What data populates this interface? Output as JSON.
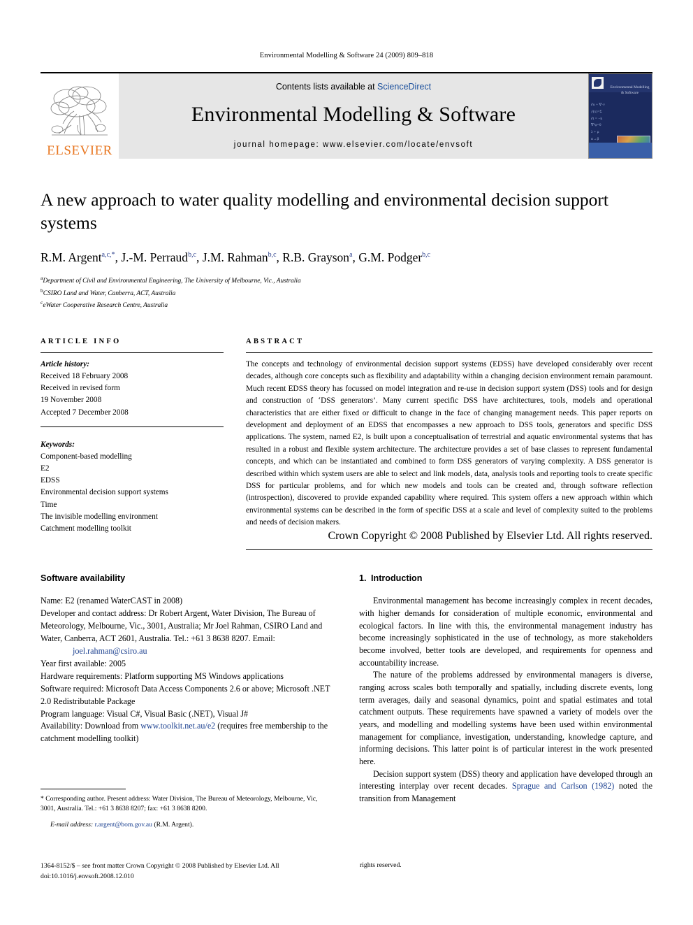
{
  "running_head": "Environmental Modelling & Software 24 (2009) 809–818",
  "masthead": {
    "publisher_name": "ELSEVIER",
    "contents_prefix": "Contents lists available at ",
    "contents_link": "ScienceDirect",
    "journal_name": "Environmental Modelling & Software",
    "homepage": "journal homepage: www.elsevier.com/locate/envsoft",
    "cover_title": "Environmental Modelling & Software"
  },
  "article": {
    "title": "A new approach to water quality modelling and environmental decision support systems",
    "authors": [
      {
        "name": "R.M. Argent",
        "sup": "a,c,*"
      },
      {
        "name": "J.-M. Perraud",
        "sup": "b,c"
      },
      {
        "name": "J.M. Rahman",
        "sup": "b,c"
      },
      {
        "name": "R.B. Grayson",
        "sup": "a"
      },
      {
        "name": "G.M. Podger",
        "sup": "b,c"
      }
    ],
    "affiliations": [
      {
        "mark": "a",
        "text": "Department of Civil and Environmental Engineering, The University of Melbourne, Vic., Australia"
      },
      {
        "mark": "b",
        "text": "CSIRO Land and Water, Canberra, ACT, Australia"
      },
      {
        "mark": "c",
        "text": "eWater Cooperative Research Centre, Australia"
      }
    ]
  },
  "article_info": {
    "heading": "ARTICLE INFO",
    "history_label": "Article history:",
    "history_lines": [
      "Received 18 February 2008",
      "Received in revised form",
      "19 November 2008",
      "Accepted 7 December 2008"
    ],
    "keywords_label": "Keywords:",
    "keywords": [
      "Component-based modelling",
      "E2",
      "EDSS",
      "Environmental decision support systems",
      "Time",
      "The invisible modelling environment",
      "Catchment modelling toolkit"
    ]
  },
  "abstract": {
    "heading": "ABSTRACT",
    "text": "The concepts and technology of environmental decision support systems (EDSS) have developed considerably over recent decades, although core concepts such as flexibility and adaptability within a changing decision environment remain paramount. Much recent EDSS theory has focussed on model integration and re-use in decision support system (DSS) tools and for design and construction of ‘DSS generators’. Many current specific DSS have architectures, tools, models and operational characteristics that are either fixed or difficult to change in the face of changing management needs. This paper reports on development and deployment of an EDSS that encompasses a new approach to DSS tools, generators and specific DSS applications. The system, named E2, is built upon a conceptualisation of terrestrial and aquatic environmental systems that has resulted in a robust and flexible system architecture. The architecture provides a set of base classes to represent fundamental concepts, and which can be instantiated and combined to form DSS generators of varying complexity. A DSS generator is described within which system users are able to select and link models, data, analysis tools and reporting tools to create specific DSS for particular problems, and for which new models and tools can be created and, through software reflection (introspection), discovered to provide expanded capability where required. This system offers a new approach within which environmental systems can be described in the form of specific DSS at a scale and level of complexity suited to the problems and needs of decision makers.",
    "copyright": "Crown Copyright © 2008 Published by Elsevier Ltd. All rights reserved."
  },
  "software_availability": {
    "heading": "Software availability",
    "entries": [
      {
        "label": "Name:",
        "text": " E2 (renamed WaterCAST in 2008)"
      },
      {
        "label": "Developer and contact address:",
        "text": " Dr Robert Argent, Water Division, The Bureau of Meteorology, Melbourne, Vic., 3001, Australia; Mr Joel Rahman, CSIRO Land and Water, Canberra, ACT 2601, Australia. Tel.: +61 3 8638 8207. Email:"
      },
      {
        "label": "Year first available:",
        "text": " 2005"
      },
      {
        "label": "Hardware requirements:",
        "text": " Platform supporting MS Windows applications"
      },
      {
        "label": "Software required:",
        "text": " Microsoft Data Access Components 2.6 or above; Microsoft .NET 2.0 Redistributable Package"
      },
      {
        "label": "Program language:",
        "text": " Visual C#, Visual Basic (.NET), Visual J#"
      },
      {
        "label": "Availability:",
        "text": " Download from "
      }
    ],
    "developer_email": "joel.rahman@csiro.au",
    "availability_link": "www.toolkit.net.au/e2",
    "availability_tail": " (requires free membership to the catchment modelling toolkit)"
  },
  "introduction": {
    "number": "1.",
    "heading": "Introduction",
    "paragraphs": [
      "Environmental management has become increasingly complex in recent decades, with higher demands for consideration of multiple economic, environmental and ecological factors. In line with this, the environmental management industry has become increasingly sophisticated in the use of technology, as more stakeholders become involved, better tools are developed, and requirements for openness and accountability increase.",
      "The nature of the problems addressed by environmental managers is diverse, ranging across scales both temporally and spatially, including discrete events, long term averages, daily and seasonal dynamics, point and spatial estimates and total catchment outputs. These requirements have spawned a variety of models over the years, and modelling and modelling systems have been used within environmental management for compliance, investigation, understanding, knowledge capture, and informing decisions. This latter point is of particular interest in the work presented here."
    ],
    "last_paragraph_pre": "Decision support system (DSS) theory and application have developed through an interesting interplay over recent decades. ",
    "last_paragraph_link": "Sprague and Carlson (1982)",
    "last_paragraph_post": " noted the transition from Management"
  },
  "footnote": {
    "corresponding": "* Corresponding author. Present address: Water Division, The Bureau of Meteorology, Melbourne, Vic, 3001, Australia. Tel.: +61 3 8638 8207; fax: +61 3 8638 8200.",
    "email_label": "E-mail address:",
    "email": "r.argent@bom.gov.au",
    "email_attrib": " (R.M. Argent)."
  },
  "footer": {
    "issn_line": "1364-8152/$ – see front matter Crown Copyright © 2008 Published by Elsevier Ltd. All",
    "rights_tail": "rights reserved.",
    "doi": "doi:10.1016/j.envsoft.2008.12.010"
  },
  "colors": {
    "link": "#1a3f8f",
    "elsevier_orange": "#E87722",
    "band_grey": "#e6e6e6"
  }
}
